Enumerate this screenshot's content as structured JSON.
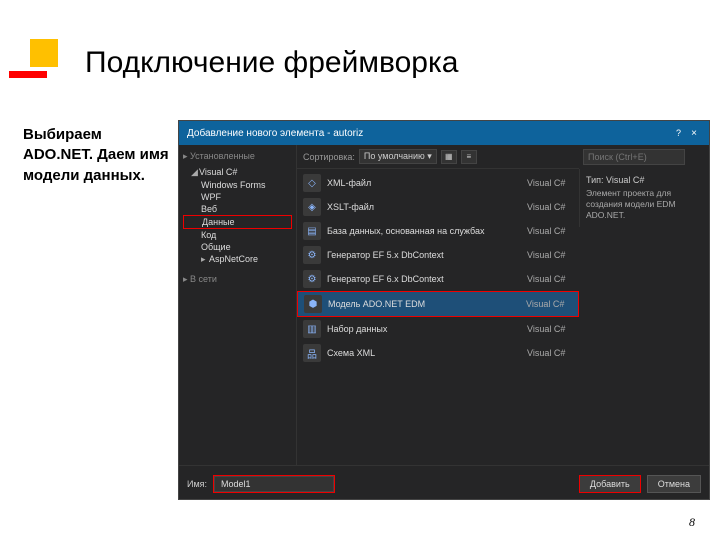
{
  "slide": {
    "title": "Подключение фреймворка",
    "caption": "Выбираем ADO.NET. Даем имя модели данных.",
    "page_number": "8"
  },
  "dialog": {
    "title": "Добавление нового элемента - autoriz",
    "close_glyph": "×",
    "tree": {
      "installed_header": "Установленные",
      "items": [
        {
          "label": "Visual C#",
          "level": 1,
          "expandable": true
        },
        {
          "label": "Windows Forms",
          "level": 2
        },
        {
          "label": "WPF",
          "level": 2
        },
        {
          "label": "Веб",
          "level": 2
        },
        {
          "label": "Данные",
          "level": 2,
          "highlight": true
        },
        {
          "label": "Код",
          "level": 2
        },
        {
          "label": "Общие",
          "level": 2
        },
        {
          "label": "AspNetCore",
          "level": 2,
          "expandable": true
        }
      ],
      "online_header": "В сети"
    },
    "sort": {
      "label": "Сортировка:",
      "value": "По умолчанию"
    },
    "search": {
      "placeholder": "Поиск (Ctrl+E)"
    },
    "templates": [
      {
        "icon": "xml",
        "name": "XML-файл",
        "lang": "Visual C#"
      },
      {
        "icon": "xsl",
        "name": "XSLT-файл",
        "lang": "Visual C#"
      },
      {
        "icon": "db",
        "name": "База данных, основанная на службах",
        "lang": "Visual C#"
      },
      {
        "icon": "ef",
        "name": "Генератор EF 5.x DbContext",
        "lang": "Visual C#"
      },
      {
        "icon": "ef",
        "name": "Генератор EF 6.x DbContext",
        "lang": "Visual C#"
      },
      {
        "icon": "edm",
        "name": "Модель ADO.NET EDM",
        "lang": "Visual C#",
        "selected": true
      },
      {
        "icon": "ds",
        "name": "Набор данных",
        "lang": "Visual C#"
      },
      {
        "icon": "xsd",
        "name": "Схема XML",
        "lang": "Visual C#"
      }
    ],
    "desc": {
      "type_label": "Тип:",
      "type_value": "Visual C#",
      "text": "Элемент проекта для создания модели EDM ADO.NET."
    },
    "footer": {
      "name_label": "Имя:",
      "name_value": "Model1",
      "add_button": "Добавить",
      "cancel_button": "Отмена"
    }
  }
}
